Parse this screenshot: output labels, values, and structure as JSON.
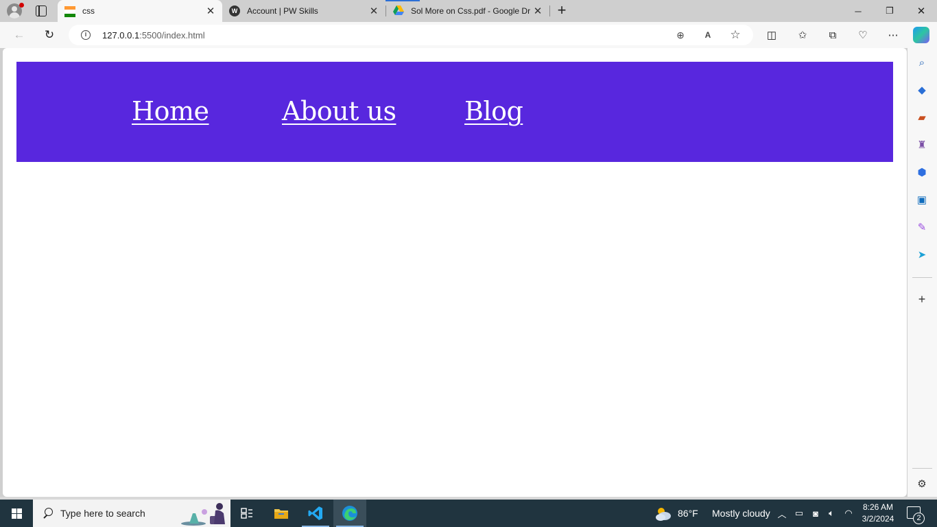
{
  "browser": {
    "tabs": [
      {
        "title": "css",
        "active": true,
        "favicon": "india-flag-icon"
      },
      {
        "title": "Account | PW Skills",
        "active": false,
        "favicon": "pw-skills-icon"
      },
      {
        "title": "Sol More on Css.pdf - Google Dr",
        "active": false,
        "favicon": "google-drive-icon"
      }
    ],
    "new_tab_label": "+",
    "window_controls": {
      "minimize": "─",
      "restore": "❐",
      "close": "✕"
    },
    "address": {
      "host": "127.0.0.1",
      "path": ":5500/index.html"
    }
  },
  "page": {
    "nav_links": [
      "Home",
      "About us",
      "Blog"
    ],
    "navbar_color": "#5827de"
  },
  "taskbar": {
    "search_placeholder": "Type here to search",
    "weather": {
      "temp": "86°F",
      "condition": "Mostly cloudy"
    },
    "time": "8:26 AM",
    "date": "3/2/2024",
    "notification_count": "2"
  }
}
